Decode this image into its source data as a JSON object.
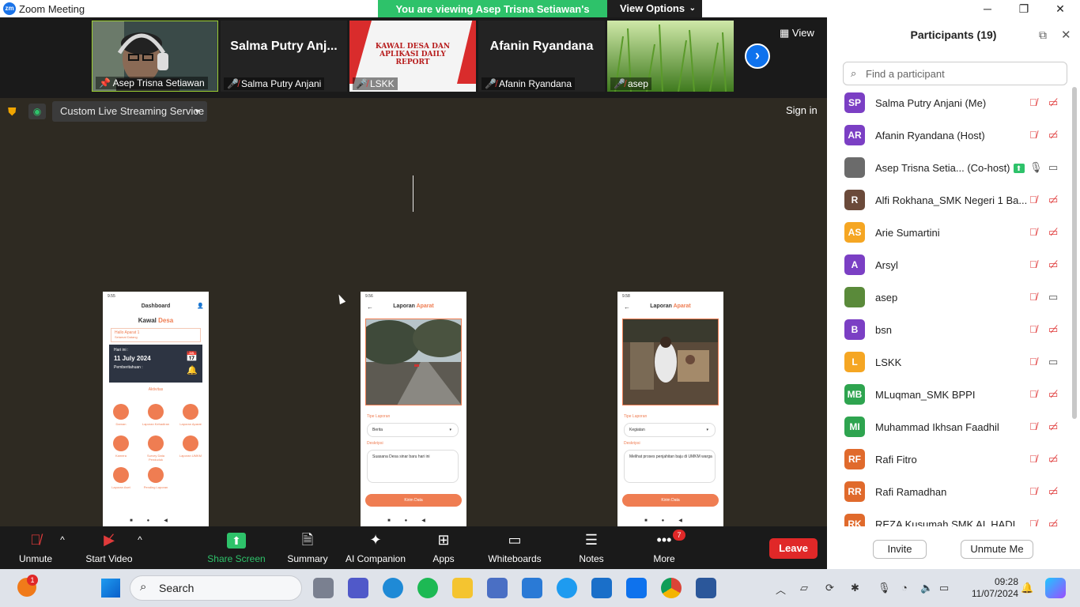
{
  "window": {
    "title": "Zoom Meeting",
    "logo_text": "zm",
    "minimize": "─",
    "maximize": "❐",
    "close": "✕"
  },
  "banner": {
    "message": "You are viewing Asep Trisna Setiawan's screen",
    "view_options": "View Options",
    "caret": "⌄"
  },
  "strip": {
    "view_label": "View",
    "next_glyph": "›",
    "thumbs": [
      {
        "label": "Asep Trisna Setiawan",
        "big_name": ""
      },
      {
        "label": "Salma Putry Anjani",
        "big_name": "Salma Putry Anj..."
      },
      {
        "label": "LSKK",
        "big_name": "",
        "slide_title": "KAWAL DESA DAN APLIKASI DAILY REPORT"
      },
      {
        "label": "Afanin Ryandana",
        "big_name": "Afanin Ryandana"
      },
      {
        "label": "asep",
        "big_name": ""
      }
    ]
  },
  "share": {
    "live_label": "Custom Live Streaming Service",
    "sign_in": "Sign in",
    "phone_dashboard": {
      "time": "9.55",
      "header": "Dashboard",
      "app_name_1": "Kawal",
      "app_name_2": "Desa",
      "hello": "Hallo Aparat 1",
      "hello_sub": "Selamat Datang",
      "today_label": "Hari ini :",
      "date": "11 July 2024",
      "notif_label": "Pemberitahuan :",
      "activity": "Aktivitas",
      "menu": [
        "Daman",
        "Laporan Kehadiran",
        "Laporan Aparat",
        "Kamera",
        "Survey Data Penduduk",
        "Laporan UMKM",
        "Laporan Aset",
        "Pending Laporan"
      ]
    },
    "phone_report1": {
      "time": "9.56",
      "header_1": "Laporan",
      "header_2": "Aparat",
      "type_label": "Tipe Laporan",
      "type_value": "Berita",
      "desc_label": "Deskripsi",
      "desc_value": "Suasana Desa sinar baru hari ini",
      "submit": "Kirim Data"
    },
    "phone_report2": {
      "time": "9.58",
      "header_1": "Laporan",
      "header_2": "Aparat",
      "type_label": "Tipe Laporan",
      "type_value": "Kegiatan",
      "desc_label": "Deskripsi",
      "desc_value": "Melihat proses penjahitan baju di UMKM warga",
      "submit": "Kirim Data"
    }
  },
  "participants": {
    "title": "Participants (19)",
    "search_placeholder": "Find a participant",
    "invite": "Invite",
    "unmute_me": "Unmute Me",
    "list": [
      {
        "initials": "SP",
        "name": "Salma Putry Anjani (Me)",
        "color": "#7b3fc4",
        "mic_on": false,
        "video_on": false
      },
      {
        "initials": "AR",
        "name": "Afanin Ryandana (Host)",
        "color": "#7b3fc4",
        "mic_on": false,
        "video_on": false
      },
      {
        "initials": "",
        "name": "Asep Trisna Setia... (Co-host)",
        "color": "#6b6b6b",
        "mic_on": true,
        "video_on": true,
        "sharing": true
      },
      {
        "initials": "R",
        "name": "Alfi Rokhana_SMK Negeri 1 Ba...",
        "color": "#6b4a3a",
        "mic_on": false,
        "video_on": false
      },
      {
        "initials": "AS",
        "name": "Arie Sumartini",
        "color": "#f5a623",
        "mic_on": false,
        "video_on": false
      },
      {
        "initials": "A",
        "name": "Arsyl",
        "color": "#7b3fc4",
        "mic_on": false,
        "video_on": false
      },
      {
        "initials": "",
        "name": "asep",
        "color": "#5a8a3a",
        "mic_on": false,
        "video_on": true
      },
      {
        "initials": "B",
        "name": "bsn",
        "color": "#7b3fc4",
        "mic_on": false,
        "video_on": false
      },
      {
        "initials": "L",
        "name": "LSKK",
        "color": "#f5a623",
        "mic_on": false,
        "video_on": true
      },
      {
        "initials": "MB",
        "name": "MLuqman_SMK BPPI",
        "color": "#2ea44f",
        "mic_on": false,
        "video_on": false
      },
      {
        "initials": "MI",
        "name": "Muhammad Ikhsan Faadhil",
        "color": "#2ea44f",
        "mic_on": false,
        "video_on": false
      },
      {
        "initials": "RF",
        "name": "Rafi Fitro",
        "color": "#e06a2c",
        "mic_on": false,
        "video_on": false
      },
      {
        "initials": "RR",
        "name": "Rafi Ramadhan",
        "color": "#e06a2c",
        "mic_on": false,
        "video_on": false
      },
      {
        "initials": "RK",
        "name": "REZA Kusumah SMK AL HADI",
        "color": "#e06a2c",
        "mic_on": false,
        "video_on": false
      }
    ]
  },
  "toolbar": {
    "unmute": "Unmute",
    "start_video": "Start Video",
    "share_screen": "Share Screen",
    "summary": "Summary",
    "ai_companion": "AI Companion",
    "apps": "Apps",
    "whiteboards": "Whiteboards",
    "notes": "Notes",
    "more": "More",
    "more_badge": "7",
    "leave": "Leave",
    "caret": "^"
  },
  "taskbar": {
    "search": "Search",
    "time": "09:28",
    "date": "11/07/2024",
    "weather_badge": "1"
  }
}
